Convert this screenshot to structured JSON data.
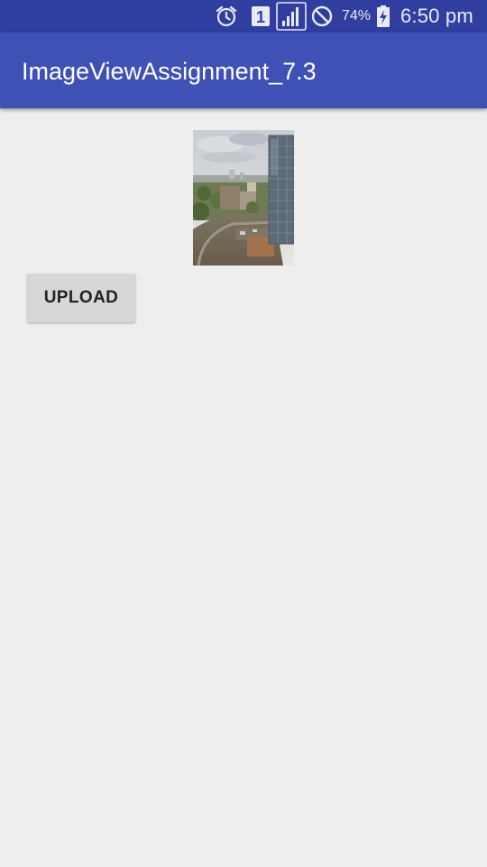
{
  "status_bar": {
    "icons": [
      "alarm-icon",
      "sim-1-icon",
      "signal-icon",
      "do-not-disturb-icon",
      "battery-charging-icon"
    ],
    "sim_label": "1",
    "battery_percent": "74%",
    "battery_level": 0.74,
    "time": "6:50 pm"
  },
  "app_bar": {
    "title": "ImageViewAssignment_7.3",
    "color": "#3f51b5",
    "status_color": "#303f9f"
  },
  "content": {
    "image_icon": "city-photo-image",
    "upload_label": "UPLOAD"
  }
}
